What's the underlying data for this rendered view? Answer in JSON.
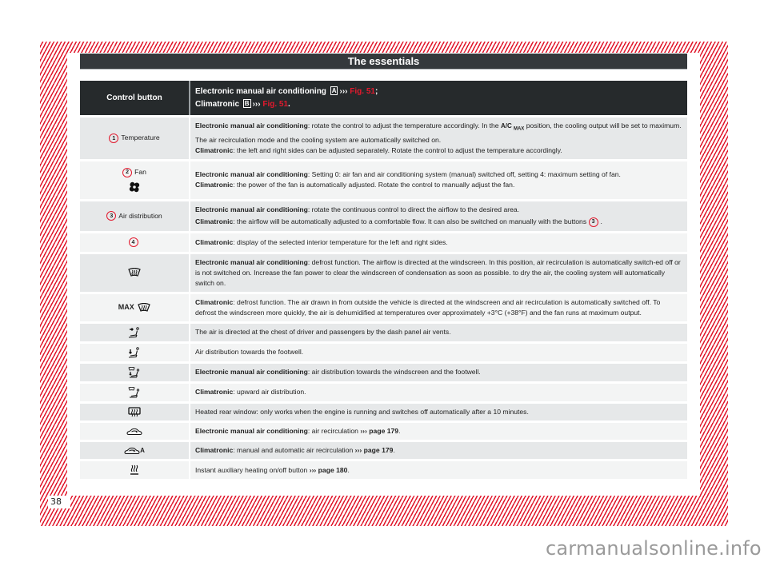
{
  "page": {
    "title": "The essentials",
    "page_number": "38",
    "watermark": "carmanualsonline.info",
    "accent_color": "#e2192d",
    "header_bg": "#262a2c"
  },
  "table": {
    "header": {
      "col1": "Control button",
      "col2_line1_text": "Electronic manual air conditioning",
      "col2_line1_box": "A",
      "col2_line1_arrow": "›››",
      "col2_line1_ref": "Fig. 51",
      "col2_line1_end": ";",
      "col2_line2_text": "Climatronic",
      "col2_line2_box": "B",
      "col2_line2_arrow": "›››",
      "col2_line2_ref": "Fig. 51",
      "col2_line2_end": "."
    },
    "rows": [
      {
        "num": "1",
        "label": "Temperature",
        "icon": "none",
        "p1_bold": "Electronic manual air conditioning",
        "p1_a": ": rotate the control to adjust the temperature accordingly. In the ",
        "p1_acmax_main": "A/C",
        "p1_acmax_sub": "MAX",
        "p1_b": " position, the cooling output will be set to maximum. The air recirculation mode and the cooling system are automatically switched on.",
        "p2_bold": "Climatronic",
        "p2_text": ": the left and right sides can be adjusted separately. Rotate the control to adjust the temperature accordingly."
      },
      {
        "num": "2",
        "label": "Fan",
        "icon": "fan-icon",
        "p1_bold": "Electronic manual air conditioning",
        "p1_text": ": Setting 0: air fan and air conditioning system (manual) switched off, setting 4: maximum setting of fan.",
        "p2_bold": "Climatronic",
        "p2_text": ": the power of the fan is automatically adjusted. Rotate the control to manually adjust the fan."
      },
      {
        "num": "3",
        "label": "Air distribution",
        "icon": "none",
        "p1_bold": "Electronic manual air conditioning",
        "p1_text": ": rotate the continuous control to direct the airflow to the desired area.",
        "p2_bold": "Climatronic",
        "p2_text": ": the airflow will be automatically adjusted to a comfortable flow. It can also be switched on manually with the buttons ",
        "p2_ref_num": "3",
        "p2_end": "."
      },
      {
        "num": "4",
        "label": "",
        "icon": "none",
        "p1_bold": "Climatronic",
        "p1_text": ": display of the selected interior temperature for the left and right sides."
      },
      {
        "icon": "windscreen-defrost-icon",
        "p1_bold": "Electronic manual air conditioning",
        "p1_text": ": defrost function. The airflow is directed at the windscreen. In this position, air recirculation is automatically switch-ed off or is not switched on. Increase the fan power to clear the windscreen of condensation as soon as possible. to dry the air, the cooling system will automatically switch on."
      },
      {
        "icon": "max-defrost-icon",
        "icon_label": "MAX",
        "p1_bold": "Climatronic",
        "p1_text": ": defrost function. The air drawn in from outside the vehicle is directed at the windscreen and air recirculation is automatically switched off. To defrost the windscreen more quickly, the air is dehumidified at temperatures over approximately +3°C (+38°F) and the fan runs at maximum output."
      },
      {
        "icon": "air-chest-icon",
        "p1_text": "The air is directed at the chest of driver and passengers by the dash panel air vents."
      },
      {
        "icon": "air-footwell-icon",
        "p1_text": "Air distribution towards the footwell."
      },
      {
        "icon": "air-windscreen-footwell-icon",
        "p1_bold": "Electronic manual air conditioning",
        "p1_text": ": air distribution towards the windscreen and the footwell."
      },
      {
        "icon": "air-upward-icon",
        "p1_bold": "Climatronic",
        "p1_text": ": upward air distribution."
      },
      {
        "icon": "rear-window-heat-icon",
        "p1_text": "Heated rear window: only works when the engine is running and switches off automatically after a 10 minutes."
      },
      {
        "icon": "recirculation-icon",
        "p1_bold": "Electronic manual air conditioning",
        "p1_text": ": air recirculation ",
        "p1_ref": "››› page 179",
        "p1_end": "."
      },
      {
        "icon": "recirculation-auto-icon",
        "icon_label": "A",
        "p1_bold": "Climatronic",
        "p1_text": ": manual and automatic air recirculation ",
        "p1_ref": "››› page 179",
        "p1_end": "."
      },
      {
        "icon": "auxiliary-heating-icon",
        "p1_text": "Instant auxiliary heating on/off button ",
        "p1_ref": "››› page 180",
        "p1_end": "."
      }
    ]
  }
}
